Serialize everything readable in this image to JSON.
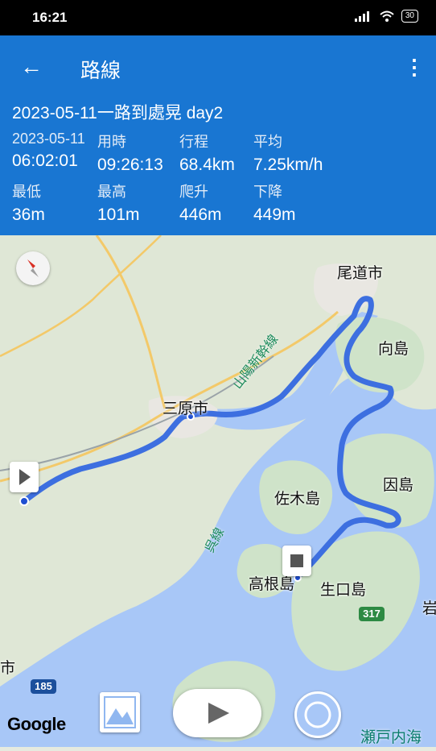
{
  "status_bar": {
    "time": "16:21",
    "battery": "30"
  },
  "header": {
    "title": "路線",
    "subtitle": "2023-05-11一路到處晃 day2",
    "stats": [
      {
        "label": "2023-05-11",
        "value": "06:02:01"
      },
      {
        "label": "用時",
        "value": "09:26:13"
      },
      {
        "label": "行程",
        "value": "68.4km"
      },
      {
        "label": "平均",
        "value": "7.25km/h"
      },
      {
        "label": "最低",
        "value": "36m"
      },
      {
        "label": "最高",
        "value": "101m"
      },
      {
        "label": "爬升",
        "value": "446m"
      },
      {
        "label": "下降",
        "value": "449m"
      }
    ]
  },
  "map": {
    "places": {
      "onomichi": "尾道市",
      "mukaishima": "向島",
      "mihara": "三原市",
      "innoshima": "因島",
      "sagishima": "佐木島",
      "takaneshima": "高根島",
      "ikuchijima": "生口島",
      "iwa": "岩",
      "city_left": "市"
    },
    "rail_labels": {
      "sanyo_shinkansen": "山陽新幹線",
      "kure_line": "呉線"
    },
    "road_numbers": {
      "r317": "317",
      "r185": "185"
    },
    "sea_label": "瀬戸内海",
    "attribution": "Google",
    "route_color": "#3d6fe0"
  }
}
